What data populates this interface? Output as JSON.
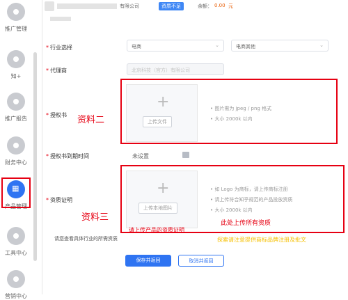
{
  "sidebar": {
    "items": [
      {
        "label": "推广管理",
        "icon": "speedometer-icon"
      },
      {
        "label": "知+",
        "icon": "plus-circle-icon"
      },
      {
        "label": "推广报告",
        "icon": "report-icon"
      },
      {
        "label": "财务中心",
        "icon": "wallet-icon"
      },
      {
        "label": "产品管理",
        "icon": "grid-icon"
      },
      {
        "label": "工具中心",
        "icon": "tool-icon"
      },
      {
        "label": "营销中心",
        "icon": "megaphone-icon"
      }
    ]
  },
  "header": {
    "company": "有限公司",
    "badge": "资质不足",
    "balance_label": "余额：",
    "balance_value": "0.00",
    "balance_unit": "元"
  },
  "form": {
    "industry_label": "行业选择",
    "industry_primary": "电商",
    "industry_secondary": "电商其他",
    "agent_label": "代理商",
    "agent_value": "北京科技（官方）有限公司",
    "license_label": "授权书",
    "license_upload_button": "上传文件",
    "license_hints": [
      "图片需为 jpeg / png 格式",
      "大小 2000k 以内"
    ],
    "license_expiry_label": "授权书到期时间",
    "license_expiry_value": "未设置",
    "qualification_label": "资质证明",
    "qualification_upload_button": "上传本地图片",
    "qualification_hints": [
      "如 Logo 为商标，请上传商标注册",
      "请上传符合知乎规范的产品投放资质",
      "大小 2000k 以内"
    ],
    "see_industry_text": "请您查看具体行业的所需资质",
    "save_button": "保存并返回",
    "cancel_button": "取消并返回"
  },
  "annotations": {
    "material2": "资料二",
    "material3": "资料三",
    "upload_all": "此处上传所有资质",
    "upload_product_cert": "请上传产品的资质证明",
    "note_yellow": "探索请注意提供商标品牌注册及批文"
  },
  "colors": {
    "primary": "#2f74f2",
    "annotation_red": "#e60012",
    "annotation_yellow": "#f6c000"
  }
}
